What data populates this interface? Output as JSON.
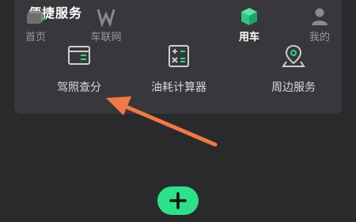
{
  "card": {
    "title": "便捷服务"
  },
  "services": [
    {
      "label": "驾照查分",
      "icon": "license-card-icon"
    },
    {
      "label": "油耗计算器",
      "icon": "calculator-icon"
    },
    {
      "label": "周边服务",
      "icon": "location-pin-icon"
    }
  ],
  "tabs": [
    {
      "label": "首页",
      "icon": "home-icon"
    },
    {
      "label": "车联网",
      "icon": "car-network-icon"
    },
    {
      "label": "",
      "icon": "plus-icon"
    },
    {
      "label": "用车",
      "icon": "cube-icon",
      "active": true
    },
    {
      "label": "我的",
      "icon": "user-icon"
    }
  ],
  "colors": {
    "accent": "#2fe08a",
    "arrow": "#f07a45",
    "background": "#2a2a2c",
    "card": "#38383c"
  }
}
